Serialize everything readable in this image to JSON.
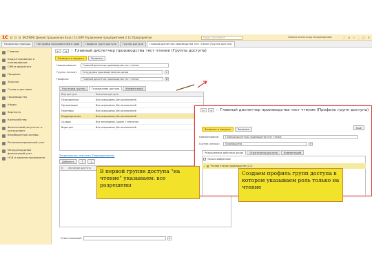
{
  "titlebar": {
    "logo": "1С",
    "title": "[КОПИЯ] Демонстрационная база / 1С:ERP Управление предприятием 2 1С:Предприятие",
    "search_placeholder": "Поиск Ctrl+Shift+F",
    "user": "Зайцев Александр Владимирович"
  },
  "tabs": [
    {
      "label": "Начальная страница"
    },
    {
      "label": "Настройки пользователей и прав"
    },
    {
      "label": "Профили групп доступа"
    },
    {
      "label": "Группы доступа"
    },
    {
      "label": "Главный диспетчер производства тест чтение (Группа доступа)"
    }
  ],
  "sidebar": {
    "items": [
      {
        "label": "Главное"
      },
      {
        "label": "Бюджетирование и планирование"
      },
      {
        "label": "CRM и маркетинг"
      },
      {
        "label": "Продажи"
      },
      {
        "label": "Закупки"
      },
      {
        "label": "Склад и доставка"
      },
      {
        "label": "Производство"
      },
      {
        "label": "Кадры"
      },
      {
        "label": "Зарплата"
      },
      {
        "label": "Казначейство"
      },
      {
        "label": "Финансовый результат и контроллинг"
      },
      {
        "label": "Внеоборотные активы"
      },
      {
        "label": "Регламентированный учет"
      },
      {
        "label": "Международный финансовый учет"
      },
      {
        "label": "НСИ и администрирование"
      }
    ]
  },
  "doc": {
    "title": "Главный диспетчер производства тест чтение (Группа доступа)",
    "save_close": "Записать и закрыть",
    "save": "Записать",
    "fields": [
      {
        "label": "Наименование:",
        "value": "Главный диспетчер производства тест чтение"
      },
      {
        "label": "Группа (папка):",
        "value": "Сотрудники производственных цехов"
      },
      {
        "label": "Профиль:",
        "value": "Главный диспетчер производства тест чтение"
      }
    ],
    "tabs": [
      "Участники группы",
      "Ограничения доступа",
      "Комментарий"
    ],
    "table_headers": [
      "Вид доступа",
      "Значения доступа"
    ],
    "table_rows": [
      {
        "kind": "Пользователи",
        "value": "Все разрешены, без исключений"
      },
      {
        "kind": "Организации",
        "value": "Все разрешены, без исключений"
      },
      {
        "kind": "Партнеры",
        "value": "Все разрешены, без исключений"
      },
      {
        "kind": "Подразделения",
        "value": "Все разрешены, без исключений"
      },
      {
        "kind": "Склады",
        "value": "Все запрещены, кроме 1 значения"
      },
      {
        "kind": "Виды цен",
        "value": "Все разрешены, без исключений"
      }
    ],
    "allowed_label": "Запрещенные значения (Подразделения):",
    "add_label": "Добавить",
    "lower_headers": [
      "N",
      "Значение доступа"
    ],
    "responsible_label": "Ответственный:"
  },
  "overlay": {
    "title": "Главный диспетчер производства тест чтение (Профиль групп доступа)",
    "more_label": "Еще",
    "save_close": "Записать и закрыть",
    "save": "Записать",
    "fields": [
      {
        "label": "Наименование:",
        "value": "Главный диспетчер производства тест чтение"
      },
      {
        "label": "Группа (папка):",
        "value": "Производство"
      }
    ],
    "tabs": [
      "Разрешенные действия (роли)",
      "Ограничения доступа",
      "Комментарий"
    ],
    "checkbox_label": "Только выбранные",
    "role": "Чтение этапов производства (2.2)"
  },
  "callouts": {
    "left": "В первой группе доступа \"на чтение\" указываем: все разрешены",
    "right": "Создаем профиль групп доступа в котором указываем роль только на чтение"
  },
  "colors": {
    "accent_yellow": "#fbe14b",
    "sidebar_bg": "#fbeec1",
    "highlight_red": "#e53333",
    "callout_bg": "#f3e22a"
  }
}
